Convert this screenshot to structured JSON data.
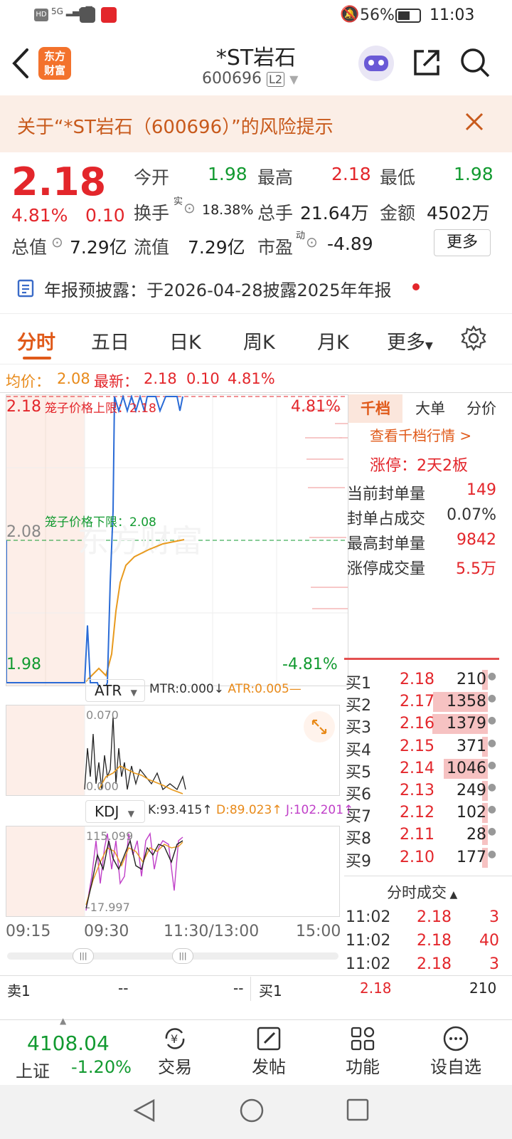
{
  "status": {
    "battery_pct": "56%",
    "time": "11:03",
    "signal": "5G"
  },
  "nav": {
    "title": "*ST岩石",
    "code": "600696",
    "level": "L2",
    "logo_text": "东方财富"
  },
  "banner": {
    "text": "关于“*ST岩石（600696）”的风险提示"
  },
  "quote": {
    "price": "2.18",
    "change_pct": "4.81%",
    "change": "0.10",
    "open_label": "今开",
    "open": "1.98",
    "high_label": "最高",
    "high": "2.18",
    "low_label": "最低",
    "low": "1.98",
    "turnover_label": "换手",
    "turnover_sup": "实",
    "turnover": "18.38%",
    "volume_label": "总手",
    "volume": "21.64万",
    "amount_label": "金额",
    "amount": "4502万",
    "mktcap_label": "总值",
    "mktcap": "7.29亿",
    "float_label": "流值",
    "float": "7.29亿",
    "pe_label": "市盈",
    "pe_sup": "动",
    "pe": "-4.89",
    "more_label": "更多",
    "notice": "年报预披露：于2026-04-28披露2025年年报"
  },
  "tabs": [
    "分时",
    "五日",
    "日K",
    "周K",
    "月K",
    "更多"
  ],
  "avg_line": {
    "avg_label": "均价：",
    "avg": "2.08",
    "latest_label": "最新：",
    "latest": "2.18",
    "chg": "0.10",
    "pct": "4.81%"
  },
  "chart": {
    "y_top": "2.18",
    "y_mid": "2.08",
    "y_bot": "1.98",
    "pct_top": "4.81%",
    "pct_bot": "-4.81%",
    "cage_up": "笼子价格上限：2.18",
    "cage_down": "笼子价格下限：2.08",
    "watermark": "东方财富",
    "atr": {
      "name": "ATR",
      "mtr": "MTR:0.000",
      "atr": "ATR:0.005",
      "max": "0.070",
      "min": "0.000"
    },
    "kdj": {
      "name": "KDJ",
      "k": "K:93.415",
      "d": "D:89.023",
      "j": "J:102.201",
      "max": "115.099",
      "min": "-17.997"
    },
    "times": [
      "09:15",
      "09:30",
      "11:30/13:00",
      "15:00"
    ],
    "colors": {
      "price": "#2a6bd6",
      "avg": "#e89a1e"
    }
  },
  "side": {
    "tabs": [
      "千档",
      "大单",
      "分价"
    ],
    "link": "查看千档行情 >",
    "limit_label": "涨停：",
    "limit": "2天2板",
    "stats": [
      {
        "label": "当前封单量",
        "value": "149"
      },
      {
        "label": "封单占成交",
        "value": "0.07%"
      },
      {
        "label": "最高封单量",
        "value": "9842"
      },
      {
        "label": "涨停成交量",
        "value": "5.5万"
      }
    ],
    "bids": [
      {
        "name": "买1",
        "price": "2.18",
        "vol": "210",
        "bar": 0.1
      },
      {
        "name": "买2",
        "price": "2.17",
        "vol": "1358",
        "bar": 0.96
      },
      {
        "name": "买3",
        "price": "2.16",
        "vol": "1379",
        "bar": 0.97
      },
      {
        "name": "买4",
        "price": "2.15",
        "vol": "371",
        "bar": 0.1
      },
      {
        "name": "买5",
        "price": "2.14",
        "vol": "1046",
        "bar": 0.78
      },
      {
        "name": "买6",
        "price": "2.13",
        "vol": "249",
        "bar": 0.1
      },
      {
        "name": "买7",
        "price": "2.12",
        "vol": "102",
        "bar": 0.1
      },
      {
        "name": "买8",
        "price": "2.11",
        "vol": "28",
        "bar": 0.1
      },
      {
        "name": "买9",
        "price": "2.10",
        "vol": "177",
        "bar": 0.1
      }
    ],
    "ticks_title": "分时成交",
    "ticks": [
      {
        "time": "11:02",
        "price": "2.18",
        "vol": "3"
      },
      {
        "time": "11:02",
        "price": "2.18",
        "vol": "40"
      },
      {
        "time": "11:02",
        "price": "2.18",
        "vol": "3"
      }
    ]
  },
  "bottom_row": {
    "sell1": "卖1",
    "sell1_price": "--",
    "sell1_vol": "--",
    "buy1": "买1",
    "buy1_price": "2.18",
    "buy1_vol": "210"
  },
  "index": {
    "value": "4108.04",
    "name": "上证",
    "pct": "-1.20%"
  },
  "bottombar": [
    {
      "label": "交易",
      "icon": "yuan-cycle-icon"
    },
    {
      "label": "发帖",
      "icon": "edit-icon"
    },
    {
      "label": "功能",
      "icon": "grid-icon"
    },
    {
      "label": "设自选",
      "icon": "more-icon"
    }
  ]
}
